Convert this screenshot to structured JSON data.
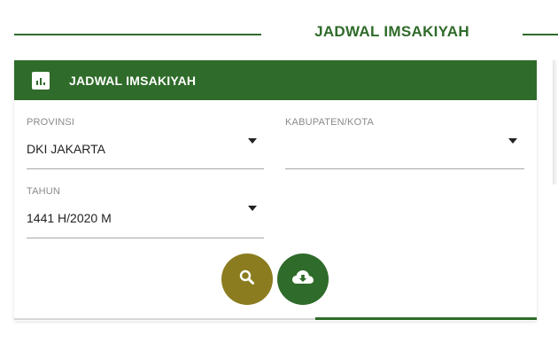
{
  "section": {
    "title": "JADWAL IMSAKIYAH"
  },
  "card": {
    "title": "JADWAL IMSAKIYAH",
    "header_icon": "bar-chart-icon"
  },
  "form": {
    "provinsi": {
      "label": "PROVINSI",
      "value": "DKI JAKARTA"
    },
    "kabupaten": {
      "label": "KABUPATEN/KOTA",
      "value": ""
    },
    "tahun": {
      "label": "TAHUN",
      "value": "1441 H/2020 M"
    }
  },
  "actions": {
    "search_icon": "search-icon",
    "download_icon": "cloud-download-icon"
  },
  "colors": {
    "primary_green": "#2f6b2a",
    "search_button": "#8b7d1f",
    "download_button": "#2f6b2a"
  }
}
